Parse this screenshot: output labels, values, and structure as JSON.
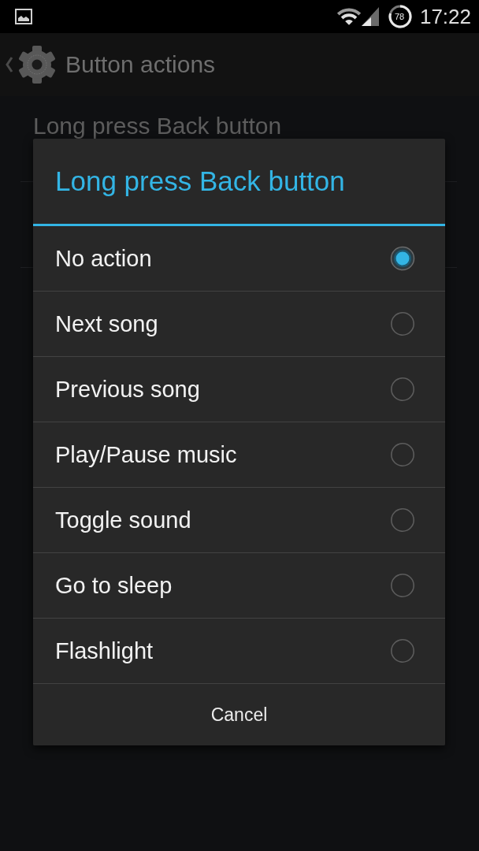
{
  "status_bar": {
    "battery": "78",
    "time": "17:22"
  },
  "action_bar": {
    "title": "Button actions"
  },
  "settings": [
    {
      "label": "Long press Back button"
    }
  ],
  "dialog": {
    "title": "Long press Back button",
    "options": [
      {
        "label": "No action",
        "selected": true
      },
      {
        "label": "Next song",
        "selected": false
      },
      {
        "label": "Previous song",
        "selected": false
      },
      {
        "label": "Play/Pause music",
        "selected": false
      },
      {
        "label": "Toggle sound",
        "selected": false
      },
      {
        "label": "Go to sleep",
        "selected": false
      },
      {
        "label": "Flashlight",
        "selected": false
      }
    ],
    "buttons": [
      "Cancel"
    ]
  }
}
